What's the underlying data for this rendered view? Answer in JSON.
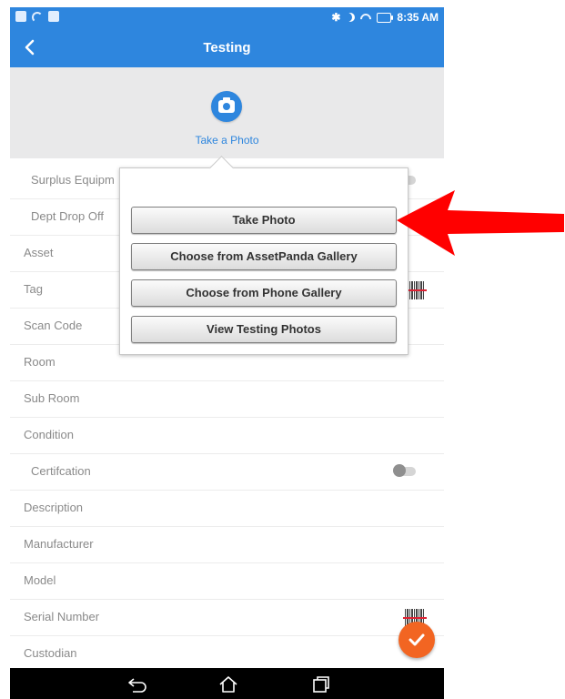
{
  "status_bar": {
    "time": "8:35 AM",
    "left_icons": [
      "notification-icon",
      "phone-icon",
      "mail-icon"
    ],
    "right_icons": [
      "bluetooth-icon",
      "do-not-disturb-icon",
      "wifi-icon",
      "battery-icon"
    ]
  },
  "app_bar": {
    "title": "Testing",
    "back_icon": "chevron-left-icon"
  },
  "photo": {
    "label": "Take a Photo",
    "icon": "camera-icon"
  },
  "fields": [
    {
      "label": "Surplus Equipm",
      "control": "toggle"
    },
    {
      "label": "Dept Drop Off",
      "control": "none"
    },
    {
      "label": "Asset",
      "control": "none"
    },
    {
      "label": "Tag",
      "control": "barcode"
    },
    {
      "label": "Scan Code",
      "control": "none"
    },
    {
      "label": "Room",
      "control": "none"
    },
    {
      "label": "Sub Room",
      "control": "none"
    },
    {
      "label": "Condition",
      "control": "none"
    },
    {
      "label": "Certifcation",
      "control": "toggle"
    },
    {
      "label": "Description",
      "control": "none"
    },
    {
      "label": "Manufacturer",
      "control": "none"
    },
    {
      "label": "Model",
      "control": "none"
    },
    {
      "label": "Serial Number",
      "control": "barcode"
    },
    {
      "label": "Custodian",
      "control": "none"
    }
  ],
  "popup_menu": {
    "items": [
      "Take Photo",
      "Choose from AssetPanda Gallery",
      "Choose from Phone Gallery",
      "View Testing Photos"
    ]
  },
  "colors": {
    "primary": "#2e86de",
    "fab": "#f26522",
    "annotation_arrow": "#ff0000"
  },
  "fab_icon": "checkmark-icon",
  "nav_icons": [
    "back-icon",
    "home-icon",
    "recent-apps-icon"
  ]
}
